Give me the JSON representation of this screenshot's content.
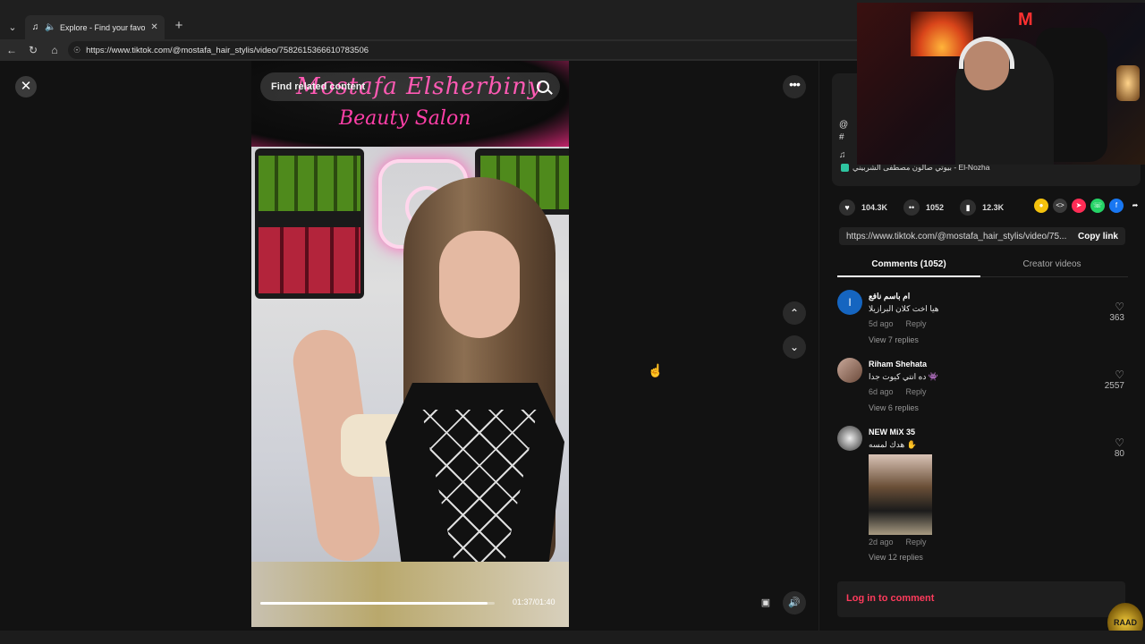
{
  "browser": {
    "tab_title": "Explore - Find your favourite",
    "url": "https://www.tiktok.com/@mostafa_hair_stylis/video/7582615366610783506"
  },
  "video": {
    "search_placeholder": "Find related content",
    "sign_line1": "Mostafa Elsherbiny",
    "sign_line2": "Beauty Salon",
    "time": "01:37/01:40",
    "progress": 0.97
  },
  "panel": {
    "music": "بيوتي صالون مصطفى الشربيني - El-Nozha",
    "meta_lines": [
      "@",
      "#"
    ],
    "likes": "104.3K",
    "comments_count": "1052",
    "saves": "12.3K",
    "share_link": "https://www.tiktok.com/@mostafa_hair_stylis/video/75...",
    "copy_link": "Copy link",
    "tab_comments": "Comments (1052)",
    "tab_creator": "Creator videos",
    "login": "Log in to comment"
  },
  "comments": [
    {
      "name": "ام باسم نافع",
      "text": "هيا اخت كلان البرازيلا",
      "time": "5d ago",
      "reply": "Reply",
      "replies": "View 7 replies",
      "likes": "363",
      "avatar_letter": "I"
    },
    {
      "name": "Riham Shehata",
      "text": "ده انتي كيوت جدا 👾",
      "time": "6d ago",
      "reply": "Reply",
      "replies": "View 6 replies",
      "likes": "2557"
    },
    {
      "name": "NEW MiX 35",
      "text": "هدك لمسه ✋",
      "time": "2d ago",
      "reply": "Reply",
      "replies": "View 12 replies",
      "likes": "80"
    }
  ],
  "watermark": "RAAD",
  "colors": {
    "accent": "#ff3b5c",
    "sign_pink": "#ff3fa8"
  }
}
